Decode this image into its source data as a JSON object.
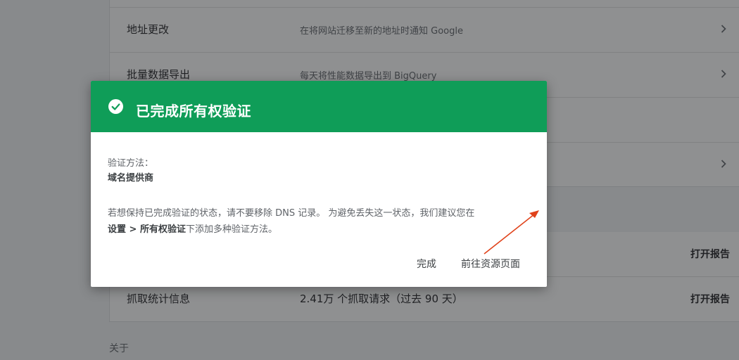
{
  "background": {
    "rows_top": [
      {
        "name": "",
        "desc": ""
      },
      {
        "name": "地址更改",
        "desc": "在将网站迁移至新的地址时通知 Google"
      },
      {
        "name": "批量数据导出",
        "desc": "每天将性能数据导出到 BigQuery"
      },
      {
        "name": "",
        "desc": ""
      }
    ],
    "rows_bottom": [
      {
        "name": "",
        "value": "",
        "action": "打开报告"
      },
      {
        "name": "抓取统计信息",
        "value": "2.41万 个抓取请求（过去 90 天）",
        "action": "打开报告"
      }
    ],
    "about": "关于"
  },
  "dialog": {
    "title": "已完成所有权验证",
    "method_label": "验证方法：",
    "method_value": "域名提供商",
    "body_part1": "若想保持已完成验证的状态，请不要移除 DNS 记录。 为避免丢失这一状态，我们建议您在",
    "body_bold": "设置 > 所有权验证",
    "body_part2": "下添加多种验证方法。",
    "done_button": "完成",
    "go_button": "前往资源页面"
  },
  "colors": {
    "header_green": "#0f9d58",
    "annotation_arrow": "#e0421a"
  },
  "icons": {
    "header_icon": "check-circle-icon",
    "row_icon": "chevron-right-icon"
  }
}
